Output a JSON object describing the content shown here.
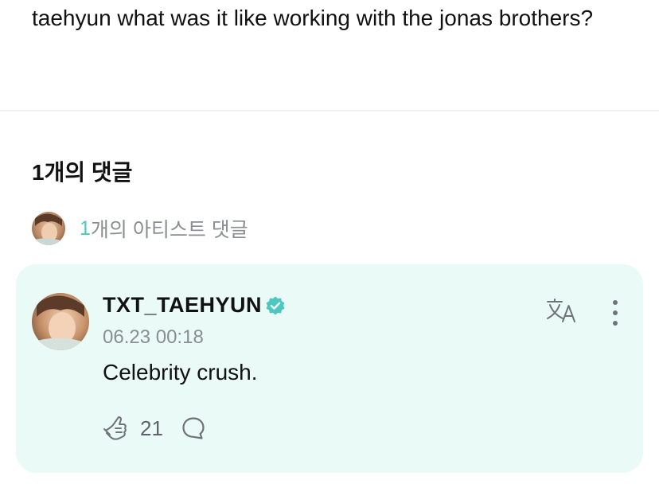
{
  "post": {
    "text": "taehyun what was it like working with the jonas brothers?"
  },
  "comments_section": {
    "count_label": "1개의 댓글",
    "artist_count": "1",
    "artist_label": "개의 아티스트 댓글"
  },
  "comment": {
    "username": "TXT_TAEHYUN",
    "timestamp": "06.23 00:18",
    "body": "Celebrity crush.",
    "like_count": "21"
  },
  "icons": {
    "verified": "verified-badge-icon",
    "translate": "translate-icon",
    "more": "more-vertical-icon",
    "like": "like-hand-icon",
    "reply": "reply-bubble-icon"
  },
  "colors": {
    "accent": "#4fc7c1",
    "card_background": "#e9faf7",
    "muted_text": "#8a8d91"
  }
}
